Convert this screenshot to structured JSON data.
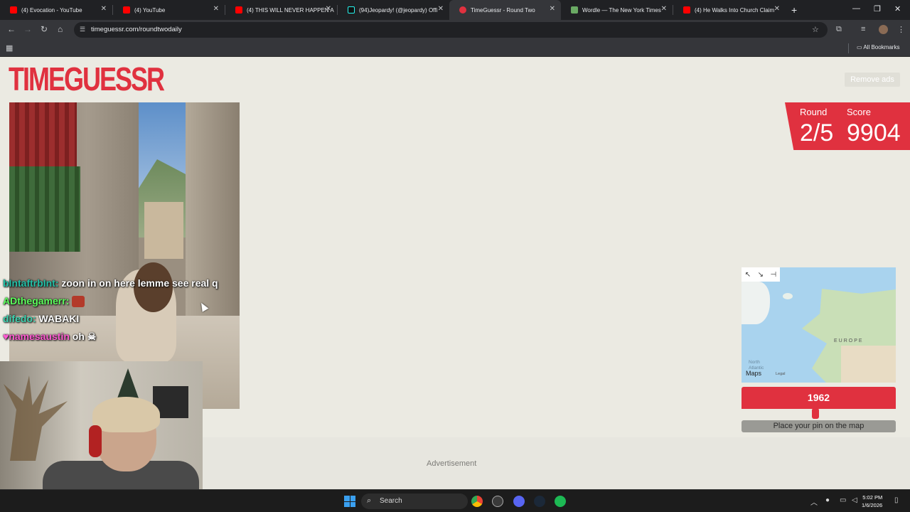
{
  "browser": {
    "tabs": [
      {
        "label": "(4) Evocation - YouTube",
        "icon": "youtube-icon",
        "active": false
      },
      {
        "label": "(4) YouTube",
        "icon": "youtube-icon",
        "active": false
      },
      {
        "label": "(4) THIS WILL NEVER HAPPEN A",
        "icon": "youtube-icon",
        "active": false
      },
      {
        "label": "(94)Jeopardy! (@jeopardy) Offi",
        "icon": "tiktok-icon",
        "active": false
      },
      {
        "label": "TimeGuessr - Round Two",
        "icon": "timeguessr-icon",
        "active": true
      },
      {
        "label": "Wordle — The New York Times",
        "icon": "wordle-icon",
        "active": false
      },
      {
        "label": "(4) He Walks Into Church Claim",
        "icon": "youtube-icon",
        "active": false
      }
    ],
    "url": "timeguessr.com/roundtwodaily",
    "bookmarks_label": "All Bookmarks"
  },
  "page": {
    "logo": "TIMEGUESSR",
    "remove_ads": "Remove ads",
    "round_label": "Round",
    "round_value": "2/5",
    "score_label": "Score",
    "score_value": "9904",
    "year": "1962",
    "year_slider_fraction": 0.48,
    "pin_button": "Place your pin on the map",
    "advertisement": "Advertisement",
    "map": {
      "region_label": "EUROPE",
      "ocean_label": "North Atlantic",
      "attribution": "Maps",
      "legal": "Legal"
    }
  },
  "chat": [
    {
      "user": "bIntaftrbInt:",
      "message": "zoon in on here lemme see real q"
    },
    {
      "user": "ADthegamerr:",
      "message": ""
    },
    {
      "user": "difedo:",
      "message": "WABAKI"
    },
    {
      "user": "namesaustin",
      "message": "oh"
    }
  ],
  "taskbar": {
    "search_label": "Search",
    "time": "5:02 PM",
    "date": "1/6/2026"
  },
  "colors": {
    "brand_red": "#e0313f",
    "page_bg": "#ebeae2"
  }
}
